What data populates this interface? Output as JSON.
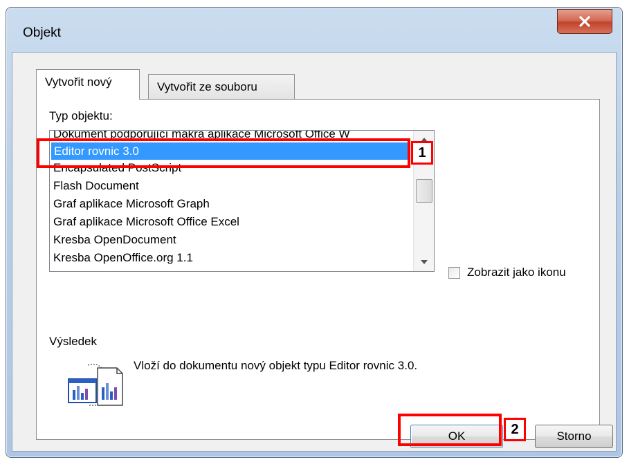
{
  "window": {
    "title": "Objekt",
    "close_glyph": "✕"
  },
  "tabs": [
    {
      "label": "Vytvořit nový",
      "active": true
    },
    {
      "label": "Vytvořit ze souboru",
      "active": false
    }
  ],
  "object_type": {
    "label": "Typ objektu:",
    "items": [
      "Dokument podporující makra aplikace Microsoft Office W",
      "Editor rovnic 3.0",
      "Encapsulated PostScript",
      "Flash Document",
      "Graf aplikace Microsoft Graph",
      "Graf aplikace Microsoft Office Excel",
      "Kresba OpenDocument",
      "Kresba OpenOffice.org 1.1"
    ],
    "selected": "Editor rovnic 3.0"
  },
  "display_as_icon": {
    "label": "Zobrazit jako ikonu",
    "checked": false
  },
  "result": {
    "label": "Výsledek",
    "text": "Vloží do dokumentu nový objekt typu Editor rovnic 3.0."
  },
  "buttons": {
    "ok": "OK",
    "cancel": "Storno"
  },
  "annotations": {
    "marker_1": "1",
    "marker_2": "2"
  },
  "colors": {
    "highlight": "#ff0000",
    "selection": "#3399ff",
    "close_button": "#c2432c"
  },
  "icons": {
    "close": "close-icon",
    "result": "object-chart-icon",
    "scroll_up": "chevron-up-icon",
    "scroll_down": "chevron-down-icon"
  }
}
